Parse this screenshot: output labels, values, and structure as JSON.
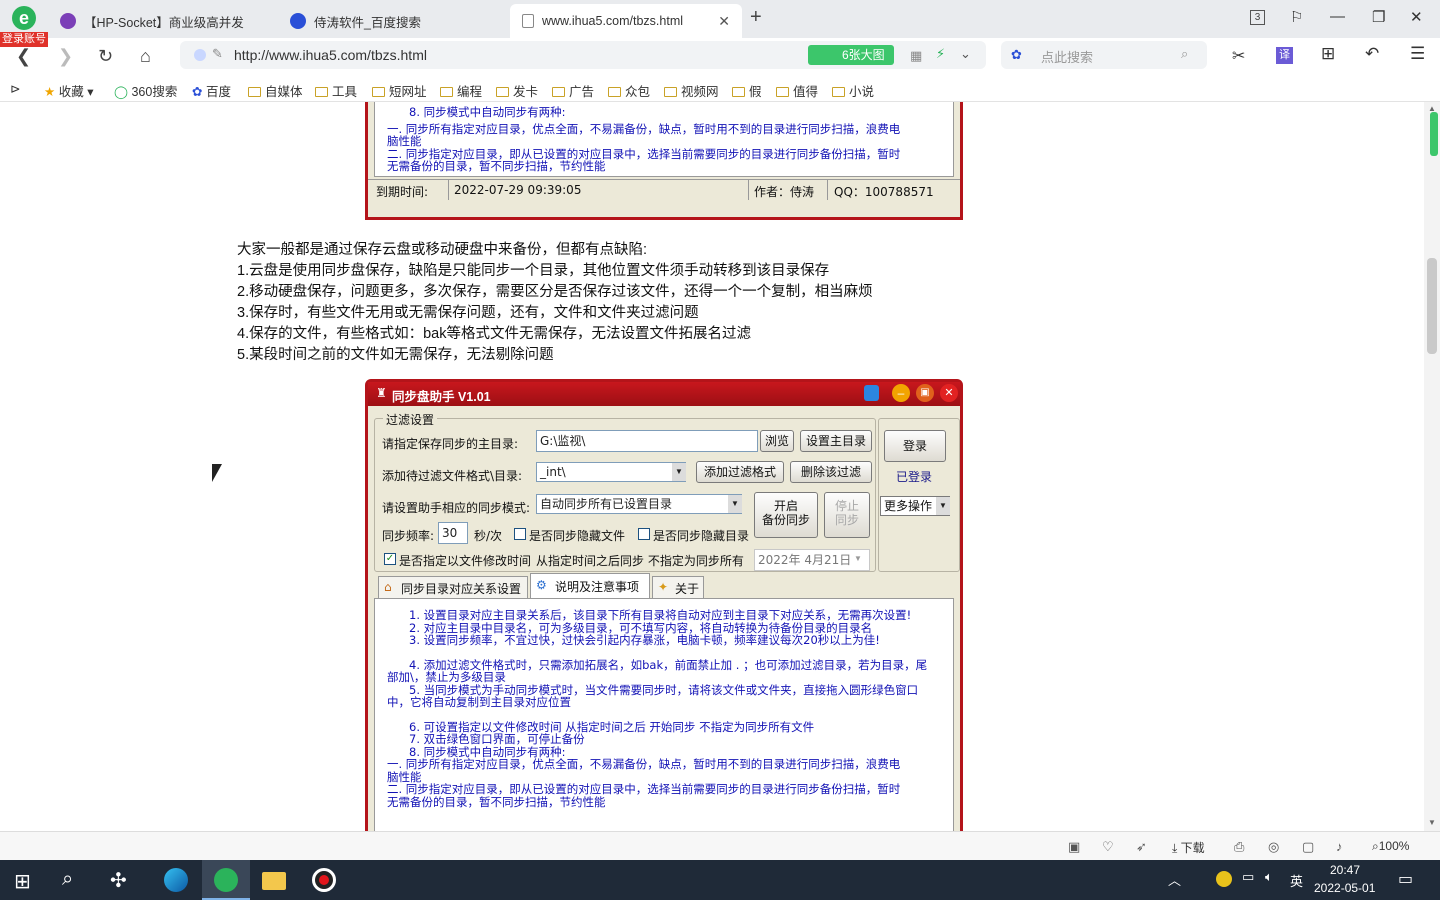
{
  "browser": {
    "login_badge": "登录账号",
    "tabs": [
      {
        "label": "【HP-Socket】商业级高并发"
      },
      {
        "label": "侍涛软件_百度搜索"
      },
      {
        "label": "www.ihua5.com/tbzs.html"
      }
    ],
    "tab_count": "3",
    "url": "http://www.ihua5.com/tbzs.html",
    "big_image_btn": "6张大图",
    "search_placeholder": "点此搜索",
    "bookmarks": [
      "收藏",
      "360搜索",
      "百度",
      "自媒体",
      "工具",
      "短网址",
      "编程",
      "发卡",
      "广告",
      "众包",
      "视频网",
      "假",
      "值得",
      "小说"
    ],
    "status": {
      "download": "下载",
      "zoom": "100%"
    }
  },
  "top_window": {
    "lines": [
      "8. 同步模式中自动同步有两种:",
      "一. 同步所有指定对应目录，优点全面，不易漏备份，缺点，暂时用不到的目录进行同步扫描，浪费电",
      "脑性能",
      "二. 同步指定对应目录，即从已设置的对应目录中，选择当前需要同步的目录进行同步备份扫描，暂时",
      "无需备份的目录，暂不同步扫描，节约性能"
    ],
    "status": {
      "expire_label": "到期时间:",
      "expire_value": "2022-07-29 09:39:05",
      "author": "作者：侍涛",
      "qq": "QQ：100788571"
    }
  },
  "article": {
    "lines": [
      "大家一般都是通过保存云盘或移动硬盘中来备份，但都有点缺陷:",
      "1.云盘是使用同步盘保存，缺陷是只能同步一个目录，其他位置文件须手动转移到该目录保存",
      "2.移动硬盘保存，问题更多，多次保存，需要区分是否保存过该文件，还得一个一个复制，相当麻烦",
      "3.保存时，有些文件无用或无需保存问题，还有，文件和文件夹过滤问题",
      "4.保存的文件，有些格式如：bak等格式文件无需保存，无法设置文件拓展名过滤",
      "5.某段时间之前的文件如无需保存，无法剔除问题"
    ]
  },
  "app": {
    "title": "同步盘助手 V1.01",
    "group_label": "过滤设置",
    "main_dir_label": "请指定保存同步的主目录:",
    "main_dir_value": "G:\\监视\\",
    "browse": "浏览",
    "set_main_dir": "设置主目录",
    "login": "登录",
    "logged_in": "已登录",
    "filter_label": "添加待过滤文件格式\\目录:",
    "filter_value": "_int\\",
    "add_filter": "添加过滤格式",
    "delete_filter": "删除该过滤",
    "mode_label": "请设置助手相应的同步模式:",
    "mode_value": "自动同步所有已设置目录",
    "start_sync_1": "开启",
    "start_sync_2": "备份同步",
    "stop_sync_1": "停止",
    "stop_sync_2": "同步",
    "more_ops": "更多操作",
    "freq_label": "同步频率:",
    "freq_value": "30",
    "freq_unit": "秒/次",
    "sync_hidden_files": "是否同步隐藏文件",
    "sync_hidden_dirs": "是否同步隐藏目录",
    "modify_time_check": "是否指定以文件修改时间",
    "modify_time_desc": "从指定时间之后同步  不指定为同步所有",
    "date_value": "2022年 4月21日",
    "tabs": [
      "同步目录对应关系设置",
      "说明及注意事项",
      "关于"
    ],
    "notes": [
      "1. 设置目录对应主目录关系后，该目录下所有目录将自动对应到主目录下对应关系，无需再次设置!",
      "2. 对应主目录中目录名，可为多级目录，可不填写内容，将自动转换为待备份目录的目录名",
      "3. 设置同步频率，不宜过快，过快会引起内存暴涨，电脑卡顿，频率建议每次20秒以上为佳!",
      "",
      "4. 添加过滤文件格式时，只需添加拓展名，如bak，前面禁止加 . ；也可添加过滤目录，若为目录，尾",
      "部加\\，禁止为多级目录",
      "5. 当同步模式为手动同步模式时，当文件需要同步时，请将该文件或文件夹，直接拖入圆形绿色窗口",
      "中，它将自动复制到主目录对应位置",
      "",
      "6. 可设置指定以文件修改时间 从指定时间之后 开始同步 不指定为同步所有文件",
      "7. 双击绿色窗口界面，可停止备份",
      "8. 同步模式中自动同步有两种:",
      "一. 同步所有指定对应目录，优点全面，不易漏备份，缺点，暂时用不到的目录进行同步扫描，浪费电",
      "脑性能",
      "二. 同步指定对应目录，即从已设置的对应目录中，选择当前需要同步的目录进行同步备份扫描，暂时",
      "无需备份的目录，暂不同步扫描，节约性能"
    ]
  },
  "taskbar": {
    "lang": "英",
    "time": "20:47",
    "date": "2022-05-01"
  }
}
